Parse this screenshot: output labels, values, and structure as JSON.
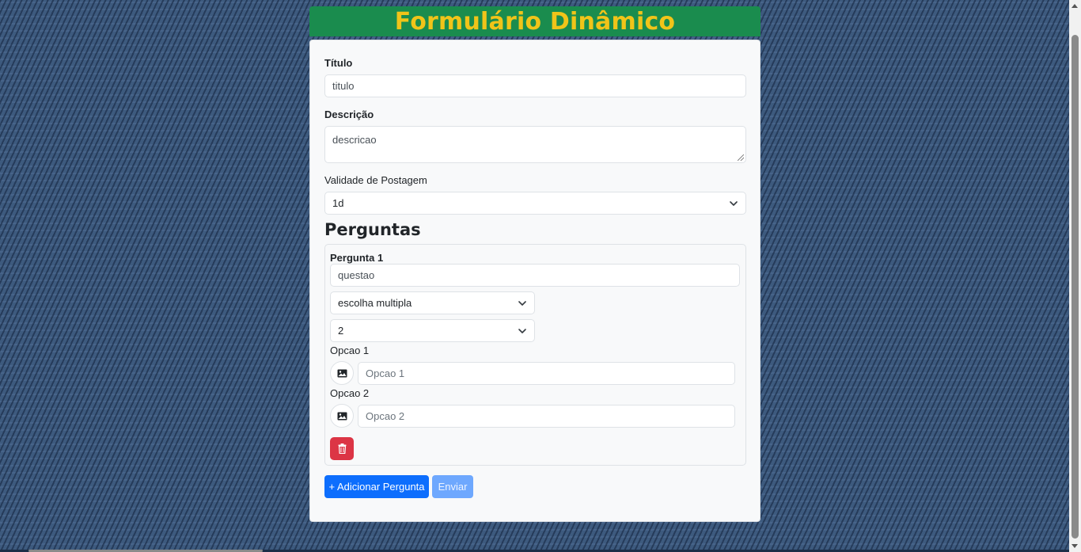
{
  "header": {
    "title": "Formulário Dinâmico"
  },
  "form": {
    "title_label": "Título",
    "title_value": "titulo",
    "description_label": "Descrição",
    "description_value": "descricao",
    "validity_label": "Validade de Postagem",
    "validity_value": "1d"
  },
  "questions": {
    "section_title": "Perguntas",
    "items": [
      {
        "label": "Pergunta 1",
        "text_value": "questao",
        "type_value": "escolha multipla",
        "options_count_value": "2",
        "options": [
          {
            "label": "Opcao 1",
            "placeholder": "Opcao 1"
          },
          {
            "label": "Opcao 2",
            "placeholder": "Opcao 2"
          }
        ]
      }
    ]
  },
  "actions": {
    "add_question_label": "+ Adicionar Pergunta",
    "submit_label": "Enviar"
  },
  "colors": {
    "header_bg": "#1a8c4e",
    "header_text": "#f0c419",
    "primary": "#0d6efd",
    "danger": "#dc3545"
  },
  "icons": {
    "image_button": "image-icon",
    "delete_button": "trash-icon",
    "select_arrow": "chevron-down-icon"
  }
}
